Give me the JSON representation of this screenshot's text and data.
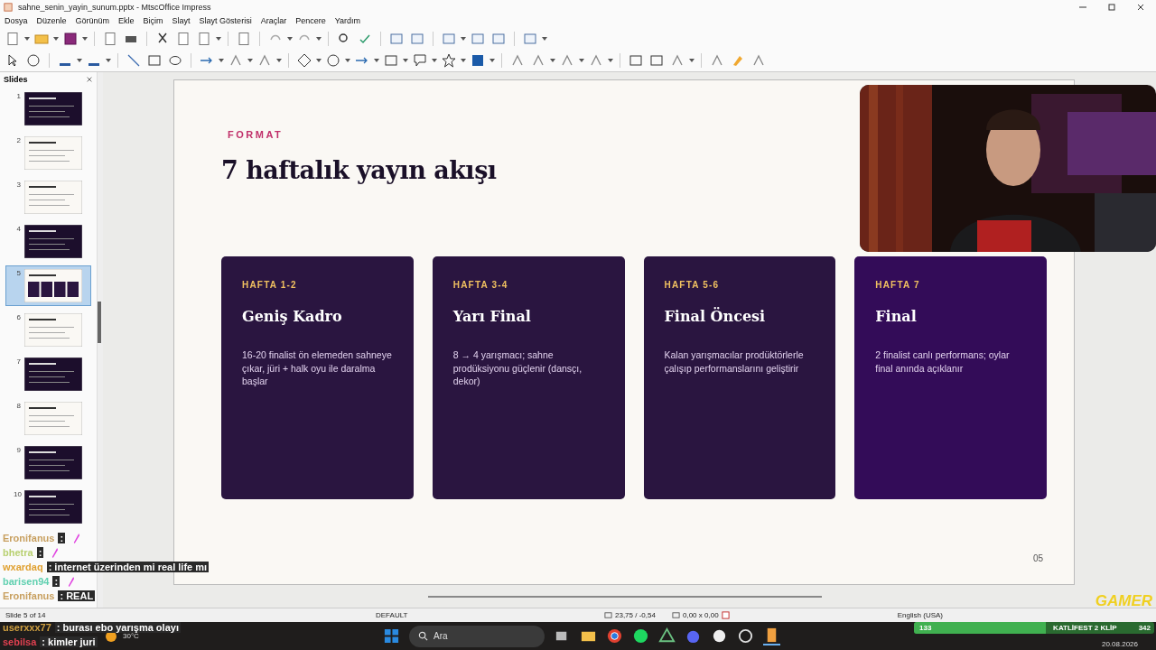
{
  "window": {
    "title": "sahne_senin_yayin_sunum.pptx - MtscOffice Impress"
  },
  "menu": [
    "Dosya",
    "Düzenle",
    "Görünüm",
    "Ekle",
    "Biçim",
    "Slayt",
    "Slayt Gösterisi",
    "Araçlar",
    "Pencere",
    "Yardım"
  ],
  "slides_panel": {
    "title": "Slides",
    "slides": [
      {
        "number": "1",
        "kind": "dark",
        "selected": false
      },
      {
        "number": "2",
        "kind": "light",
        "selected": false
      },
      {
        "number": "3",
        "kind": "light",
        "selected": false
      },
      {
        "number": "4",
        "kind": "dark",
        "selected": false
      },
      {
        "number": "5",
        "kind": "cards",
        "selected": true
      },
      {
        "number": "6",
        "kind": "light",
        "selected": false
      },
      {
        "number": "7",
        "kind": "dark",
        "selected": false
      },
      {
        "number": "8",
        "kind": "light",
        "selected": false
      },
      {
        "number": "9",
        "kind": "dark",
        "selected": false
      },
      {
        "number": "10",
        "kind": "dark",
        "selected": false
      }
    ]
  },
  "slide": {
    "eyebrow": "FORMAT",
    "title": "7 haftalık yayın akışı",
    "page": "05",
    "cards": [
      {
        "label": "HAFTA 1-2",
        "title": "Geniş Kadro",
        "body": "16-20 finalist ön elemeden sahneye çıkar, jüri + halk oyu ile daralma başlar",
        "color": "#2a1540"
      },
      {
        "label": "HAFTA 3-4",
        "title": "Yarı Final",
        "body": "8 → 4 yarışmacı; sahne prodüksiyonu güçlenir (dansçı, dekor)",
        "color": "#2a1540"
      },
      {
        "label": "HAFTA 5-6",
        "title": "Final Öncesi",
        "body": "Kalan yarışmacılar prodüktörlerle çalışıp performanslarını geliştirir",
        "color": "#2a1540"
      },
      {
        "label": "HAFTA 7",
        "title": "Final",
        "body": "2 finalist canlı performans; oylar final anında açıklanır",
        "color": "#330c58"
      }
    ]
  },
  "status_bar": {
    "slide": "Slide 5 of 14",
    "layout": "DEFAULT",
    "position": "23,75 / -0,54",
    "size": "0,00 x 0,00",
    "language": "English (USA)"
  },
  "taskbar": {
    "weather": "30°C",
    "search": "Ara",
    "date": "20.08.2026"
  },
  "chat": [
    {
      "user": "Eronifanus",
      "color": "#c8a060",
      "message": ":",
      "emote": true
    },
    {
      "user": "bhetra",
      "color": "#b8d070",
      "message": ":",
      "emote": true
    },
    {
      "user": "wxardaq",
      "color": "#e0a030",
      "message": ": internet üzerinden mi real life mı"
    },
    {
      "user": "barisen94",
      "color": "#60d0b0",
      "message": ":",
      "emote": true
    },
    {
      "user": "Eronifanus",
      "color": "#c8a060",
      "message": ": REAL"
    },
    {
      "user": "userxxx77",
      "color": "#d0a040",
      "message": ": burası ebo yarışma olayı"
    },
    {
      "user": "sebilsa",
      "color": "#e04050",
      "message": ": kimler juri"
    }
  ],
  "stream_goal": {
    "count": "133",
    "title": "KATLİFEST 2 KLİP",
    "value": "342",
    "level": 0.55
  },
  "stream_logo": "GAMER"
}
